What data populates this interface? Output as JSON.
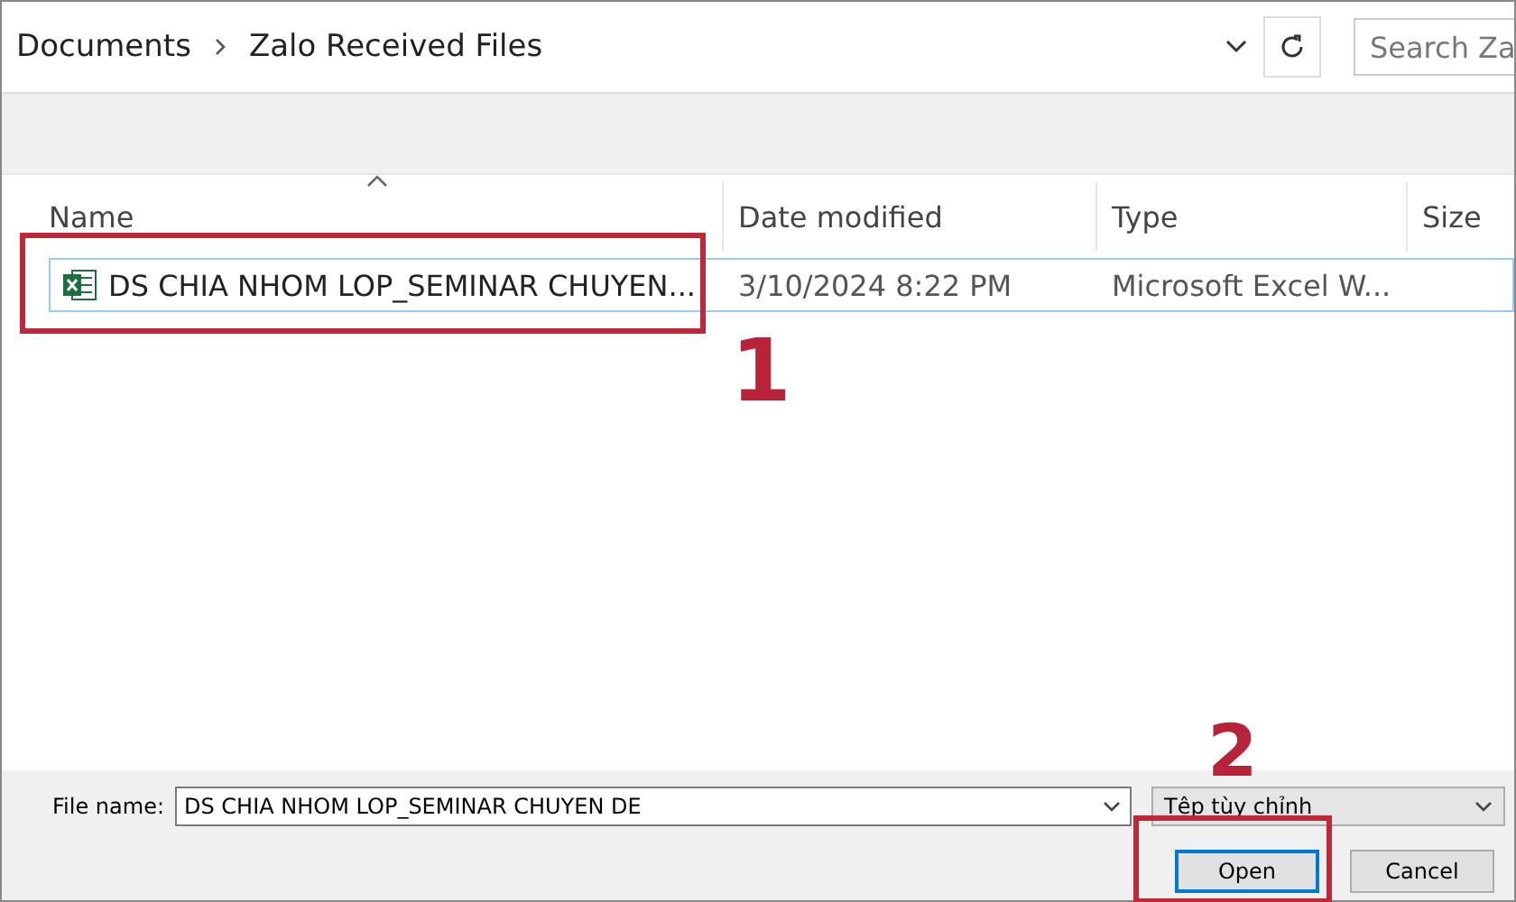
{
  "breadcrumb": [
    {
      "label": "Documents"
    },
    {
      "label": "Zalo Received Files"
    }
  ],
  "search": {
    "placeholder": "Search Za"
  },
  "columns": [
    {
      "label": "Name",
      "sorted": true
    },
    {
      "label": "Date modified",
      "sorted": false
    },
    {
      "label": "Type",
      "sorted": false
    },
    {
      "label": "Size",
      "sorted": false
    }
  ],
  "files": [
    {
      "name": "DS CHIA NHOM LOP_SEMINAR CHUYEN...",
      "date": "3/10/2024 8:22 PM",
      "type": "Microsoft Excel W...",
      "selected": true
    }
  ],
  "file_name": {
    "label": "File name:",
    "value": "DS CHIA NHOM LOP_SEMINAR CHUYEN DE"
  },
  "file_type": {
    "value": "Tệp tùy chỉnh"
  },
  "buttons": [
    {
      "label": "Open",
      "default": true
    },
    {
      "label": "Cancel",
      "default": false
    }
  ],
  "annotations": [
    {
      "number": "1"
    },
    {
      "number": "2"
    }
  ]
}
